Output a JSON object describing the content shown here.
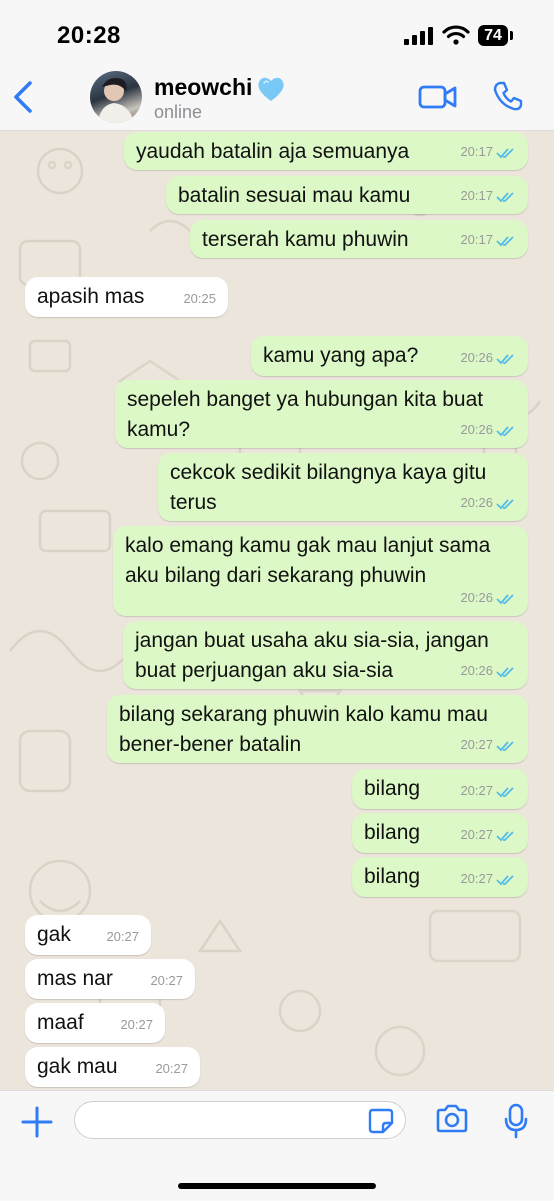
{
  "status_bar": {
    "time": "20:28",
    "battery": "74"
  },
  "header": {
    "contact_name": "meowchi",
    "contact_status": "online"
  },
  "messages": [
    {
      "text": "yaudah batalin aja semuanya",
      "time": "20:17"
    },
    {
      "text": "batalin sesuai mau kamu",
      "time": "20:17"
    },
    {
      "text": "terserah kamu phuwin",
      "time": "20:17"
    },
    {
      "text": "apasih mas",
      "time": "20:25"
    },
    {
      "text": "kamu yang apa?",
      "time": "20:26"
    },
    {
      "text": "sepeleh banget ya hubungan kita buat\nkamu?",
      "time": "20:26"
    },
    {
      "text": "cekcok sedikit bilangnya kaya gitu\nterus",
      "time": "20:26"
    },
    {
      "text": "kalo emang kamu gak mau lanjut sama\naku bilang dari sekarang phuwin",
      "time": "20:26"
    },
    {
      "text": "jangan buat usaha aku sia-sia, jangan\nbuat perjuangan aku sia-sia",
      "time": "20:26"
    },
    {
      "text": "bilang sekarang phuwin kalo kamu mau\nbener-bener batalin",
      "time": "20:27"
    },
    {
      "text": "bilang",
      "time": "20:27"
    },
    {
      "text": "bilang",
      "time": "20:27"
    },
    {
      "text": "bilang",
      "time": "20:27"
    },
    {
      "text": "gak",
      "time": "20:27"
    },
    {
      "text": "mas nar",
      "time": "20:27"
    },
    {
      "text": "maaf",
      "time": "20:27"
    },
    {
      "text": "gak mau",
      "time": "20:27"
    }
  ],
  "colors": {
    "accent": "#2f7cf6",
    "outgoing_bubble": "#dcf8c6",
    "incoming_bubble": "#ffffff",
    "read_ticks": "#53bdeb",
    "heart": "#7ac8f5"
  }
}
